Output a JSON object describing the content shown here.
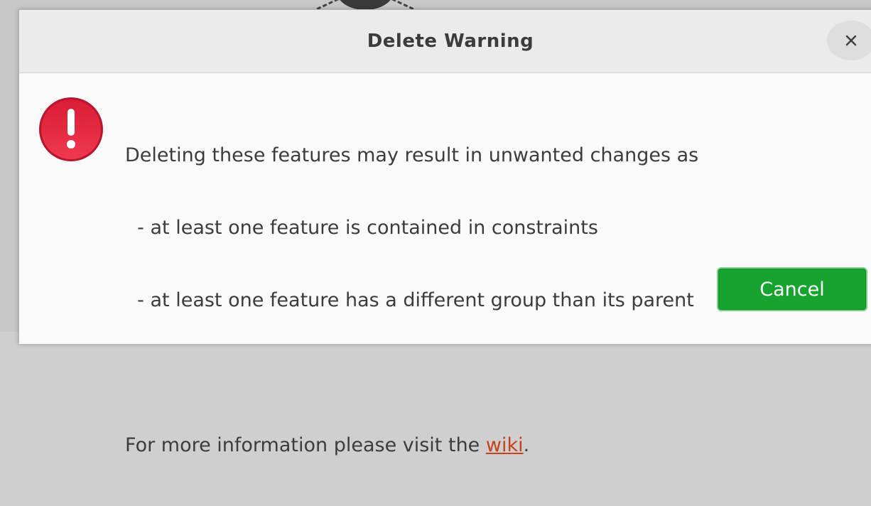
{
  "dialog": {
    "title": "Delete Warning",
    "close_icon": "close-icon",
    "status_icon": "error-icon",
    "message": {
      "line1": "Deleting these features may result in unwanted changes as",
      "line2": "  - at least one feature is contained in constraints",
      "line3": "  - at least one feature has a different group than its parent",
      "info_prefix": "For more information please visit the ",
      "link_text": "wiki",
      "info_suffix": "."
    },
    "buttons": {
      "cancel_label": "Cancel"
    }
  },
  "colors": {
    "title_bar": "#ebebeb",
    "dialog_bg": "#fafafa",
    "error_red": "#e8203a",
    "link": "#c7411a",
    "cancel_button": "#16a32f"
  }
}
